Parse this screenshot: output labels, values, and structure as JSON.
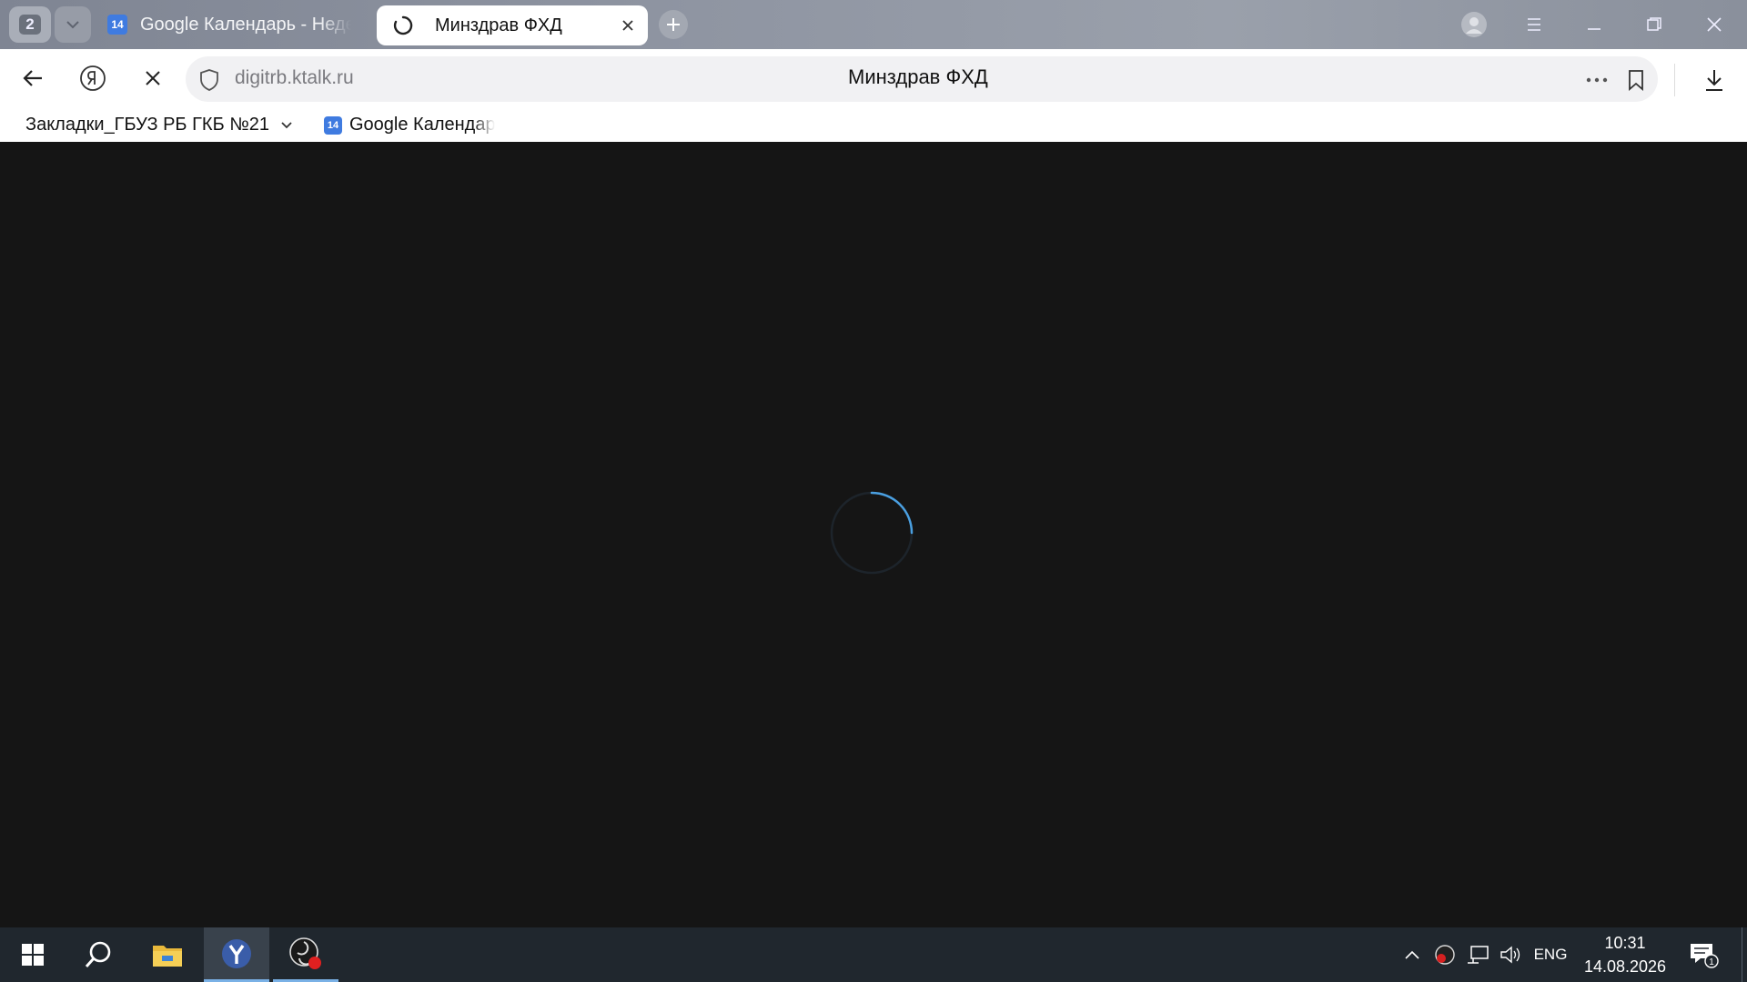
{
  "browser": {
    "tab_count": "2",
    "tabs": [
      {
        "favicon_text": "14",
        "title": "Google Календарь - Неделя",
        "active": false
      },
      {
        "title": "Минздрав ФХД",
        "active": true,
        "loading": true
      }
    ],
    "address": {
      "url": "digitrb.ktalk.ru",
      "page_title": "Минздрав ФХД"
    },
    "bookmarks": [
      {
        "label": "Закладки_ГБУЗ РБ ГКБ №21",
        "type": "folder"
      },
      {
        "label": "Google Календарь",
        "favicon_text": "14"
      }
    ]
  },
  "content": {
    "state": "loading",
    "spinner_color": "#4a9fe0"
  },
  "taskbar": {
    "language": "ENG",
    "time": "10:31",
    "date": "14.08.2026",
    "notification_count": "1"
  },
  "colors": {
    "content_bg": "#151515",
    "taskbar_bg": "#20272e",
    "accent": "#7ab1e6"
  }
}
